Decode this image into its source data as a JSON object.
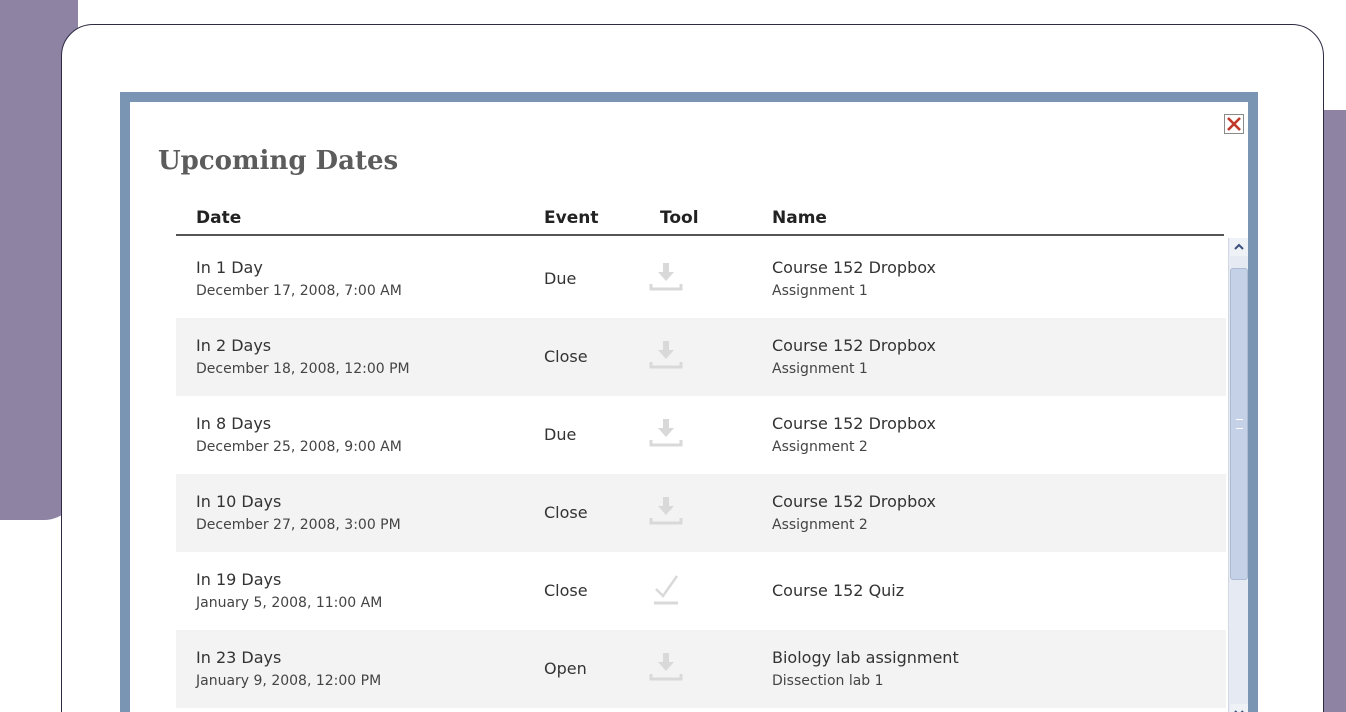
{
  "dialog": {
    "title": "Upcoming Dates",
    "close_icon": "close-x-icon",
    "accent_color": "#7995b3",
    "close_color": "#c0392b"
  },
  "table": {
    "headers": [
      "Date",
      "Event",
      "Tool",
      "Name"
    ],
    "rows": [
      {
        "relative": "In 1 Day",
        "date": "December 17, 2008, 7:00 AM",
        "event": "Due",
        "tool": "dropbox-download-icon",
        "name": "Course 152 Dropbox",
        "subname": "Assignment 1"
      },
      {
        "relative": "In 2 Days",
        "date": "December 18, 2008, 12:00 PM",
        "event": "Close",
        "tool": "dropbox-download-icon",
        "name": "Course 152 Dropbox",
        "subname": "Assignment 1"
      },
      {
        "relative": "In 8 Days",
        "date": "December 25, 2008, 9:00 AM",
        "event": "Due",
        "tool": "dropbox-download-icon",
        "name": "Course 152 Dropbox",
        "subname": "Assignment 2"
      },
      {
        "relative": "In 10 Days",
        "date": "December 27, 2008, 3:00 PM",
        "event": "Close",
        "tool": "dropbox-download-icon",
        "name": "Course 152 Dropbox",
        "subname": "Assignment 2"
      },
      {
        "relative": "In 19 Days",
        "date": "January 5, 2008, 11:00 AM",
        "event": "Close",
        "tool": "quiz-check-icon",
        "name": "Course 152 Quiz",
        "subname": ""
      },
      {
        "relative": "In 23 Days",
        "date": "January 9, 2008, 12:00 PM",
        "event": "Open",
        "tool": "dropbox-download-icon",
        "name": "Biology lab assignment",
        "subname": "Dissection lab 1"
      }
    ]
  },
  "scrollbar": {
    "up_icon": "chevron-up-icon",
    "down_icon": "chevron-down-icon"
  }
}
